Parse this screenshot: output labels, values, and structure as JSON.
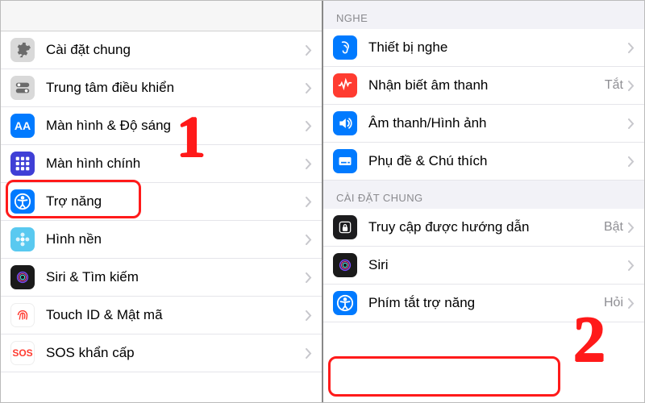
{
  "left": {
    "items": [
      {
        "label": "Cài đặt chung",
        "icon": "gear",
        "bg": "#d9d9d9",
        "fg": "#6b6b6b"
      },
      {
        "label": "Trung tâm điều khiển",
        "icon": "switch",
        "bg": "#d9d9d9",
        "fg": "#6b6b6b"
      },
      {
        "label": "Màn hình & Độ sáng",
        "icon": "aa",
        "bg": "#007aff",
        "fg": "#ffffff"
      },
      {
        "label": "Màn hình chính",
        "icon": "grid",
        "bg": "#3f3fd6",
        "fg": "#ffffff"
      },
      {
        "label": "Trợ năng",
        "icon": "accessibility",
        "bg": "#007aff",
        "fg": "#ffffff"
      },
      {
        "label": "Hình nền",
        "icon": "flower",
        "bg": "#59c9f0",
        "fg": "#ffffff"
      },
      {
        "label": "Siri & Tìm kiếm",
        "icon": "siri",
        "bg": "#1a1a1a",
        "fg": "#ffffff"
      },
      {
        "label": "Touch ID & Mật mã",
        "icon": "touchid",
        "bg": "#ffffff",
        "fg": "#ff3b30"
      },
      {
        "label": "SOS khẩn cấp",
        "icon": "sos",
        "bg": "#ffffff",
        "fg": "#ff3b30"
      }
    ]
  },
  "right": {
    "sections": [
      {
        "header": "NGHE",
        "items": [
          {
            "label": "Thiết bị nghe",
            "icon": "ear",
            "bg": "#007aff",
            "fg": "#ffffff",
            "value": ""
          },
          {
            "label": "Nhận biết âm thanh",
            "icon": "wave",
            "bg": "#ff3b30",
            "fg": "#ffffff",
            "value": "Tắt"
          },
          {
            "label": "Âm thanh/Hình ảnh",
            "icon": "speaker",
            "bg": "#007aff",
            "fg": "#ffffff",
            "value": ""
          },
          {
            "label": "Phụ đề & Chú thích",
            "icon": "subtitle",
            "bg": "#007aff",
            "fg": "#ffffff",
            "value": ""
          }
        ]
      },
      {
        "header": "CÀI ĐẶT CHUNG",
        "items": [
          {
            "label": "Truy cập được hướng dẫn",
            "icon": "lock",
            "bg": "#1c1c1e",
            "fg": "#ffffff",
            "value": "Bật"
          },
          {
            "label": "Siri",
            "icon": "siri",
            "bg": "#1a1a1a",
            "fg": "#ffffff",
            "value": ""
          },
          {
            "label": "Phím tắt trợ năng",
            "icon": "accessibility",
            "bg": "#007aff",
            "fg": "#ffffff",
            "value": "Hỏi"
          }
        ]
      }
    ]
  },
  "annotations": {
    "step1": "1",
    "step2": "2"
  }
}
